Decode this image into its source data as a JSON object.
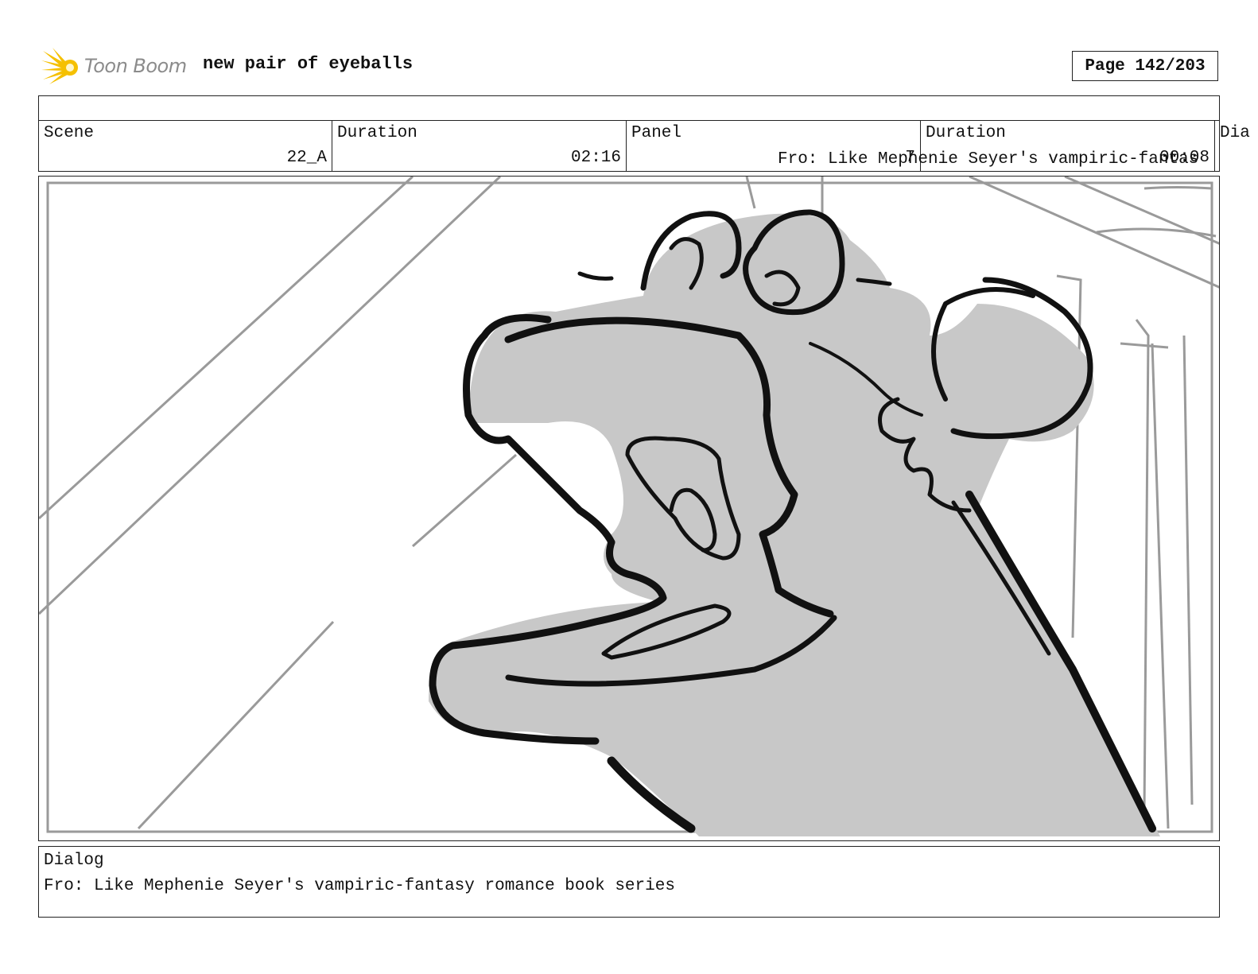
{
  "header": {
    "logo_text": "Toon Boom",
    "project_title": "new pair of eyeballs",
    "page_label": "Page 142/203"
  },
  "info": {
    "scene_label": "Scene",
    "scene_value": "22_A",
    "duration_label": "Duration",
    "duration_value": "02:16",
    "panel_label": "Panel",
    "panel_value": "7",
    "panel_duration_label": "Duration",
    "panel_duration_value": "00:08",
    "dialog_label_truncated": "Dia",
    "dialog_overflow_text": "Fro: Like Mephenie Seyer's vampiric-fantas"
  },
  "dialog": {
    "label": "Dialog",
    "text": "Fro: Like Mephenie Seyer's vampiric-fantasy romance book series"
  },
  "colors": {
    "logo_yellow": "#f5c000",
    "logo_gray": "#8b8b8b",
    "fill_gray": "#c8c8c8",
    "line_black": "#111111",
    "bg_lines": "#9a9a9a"
  }
}
